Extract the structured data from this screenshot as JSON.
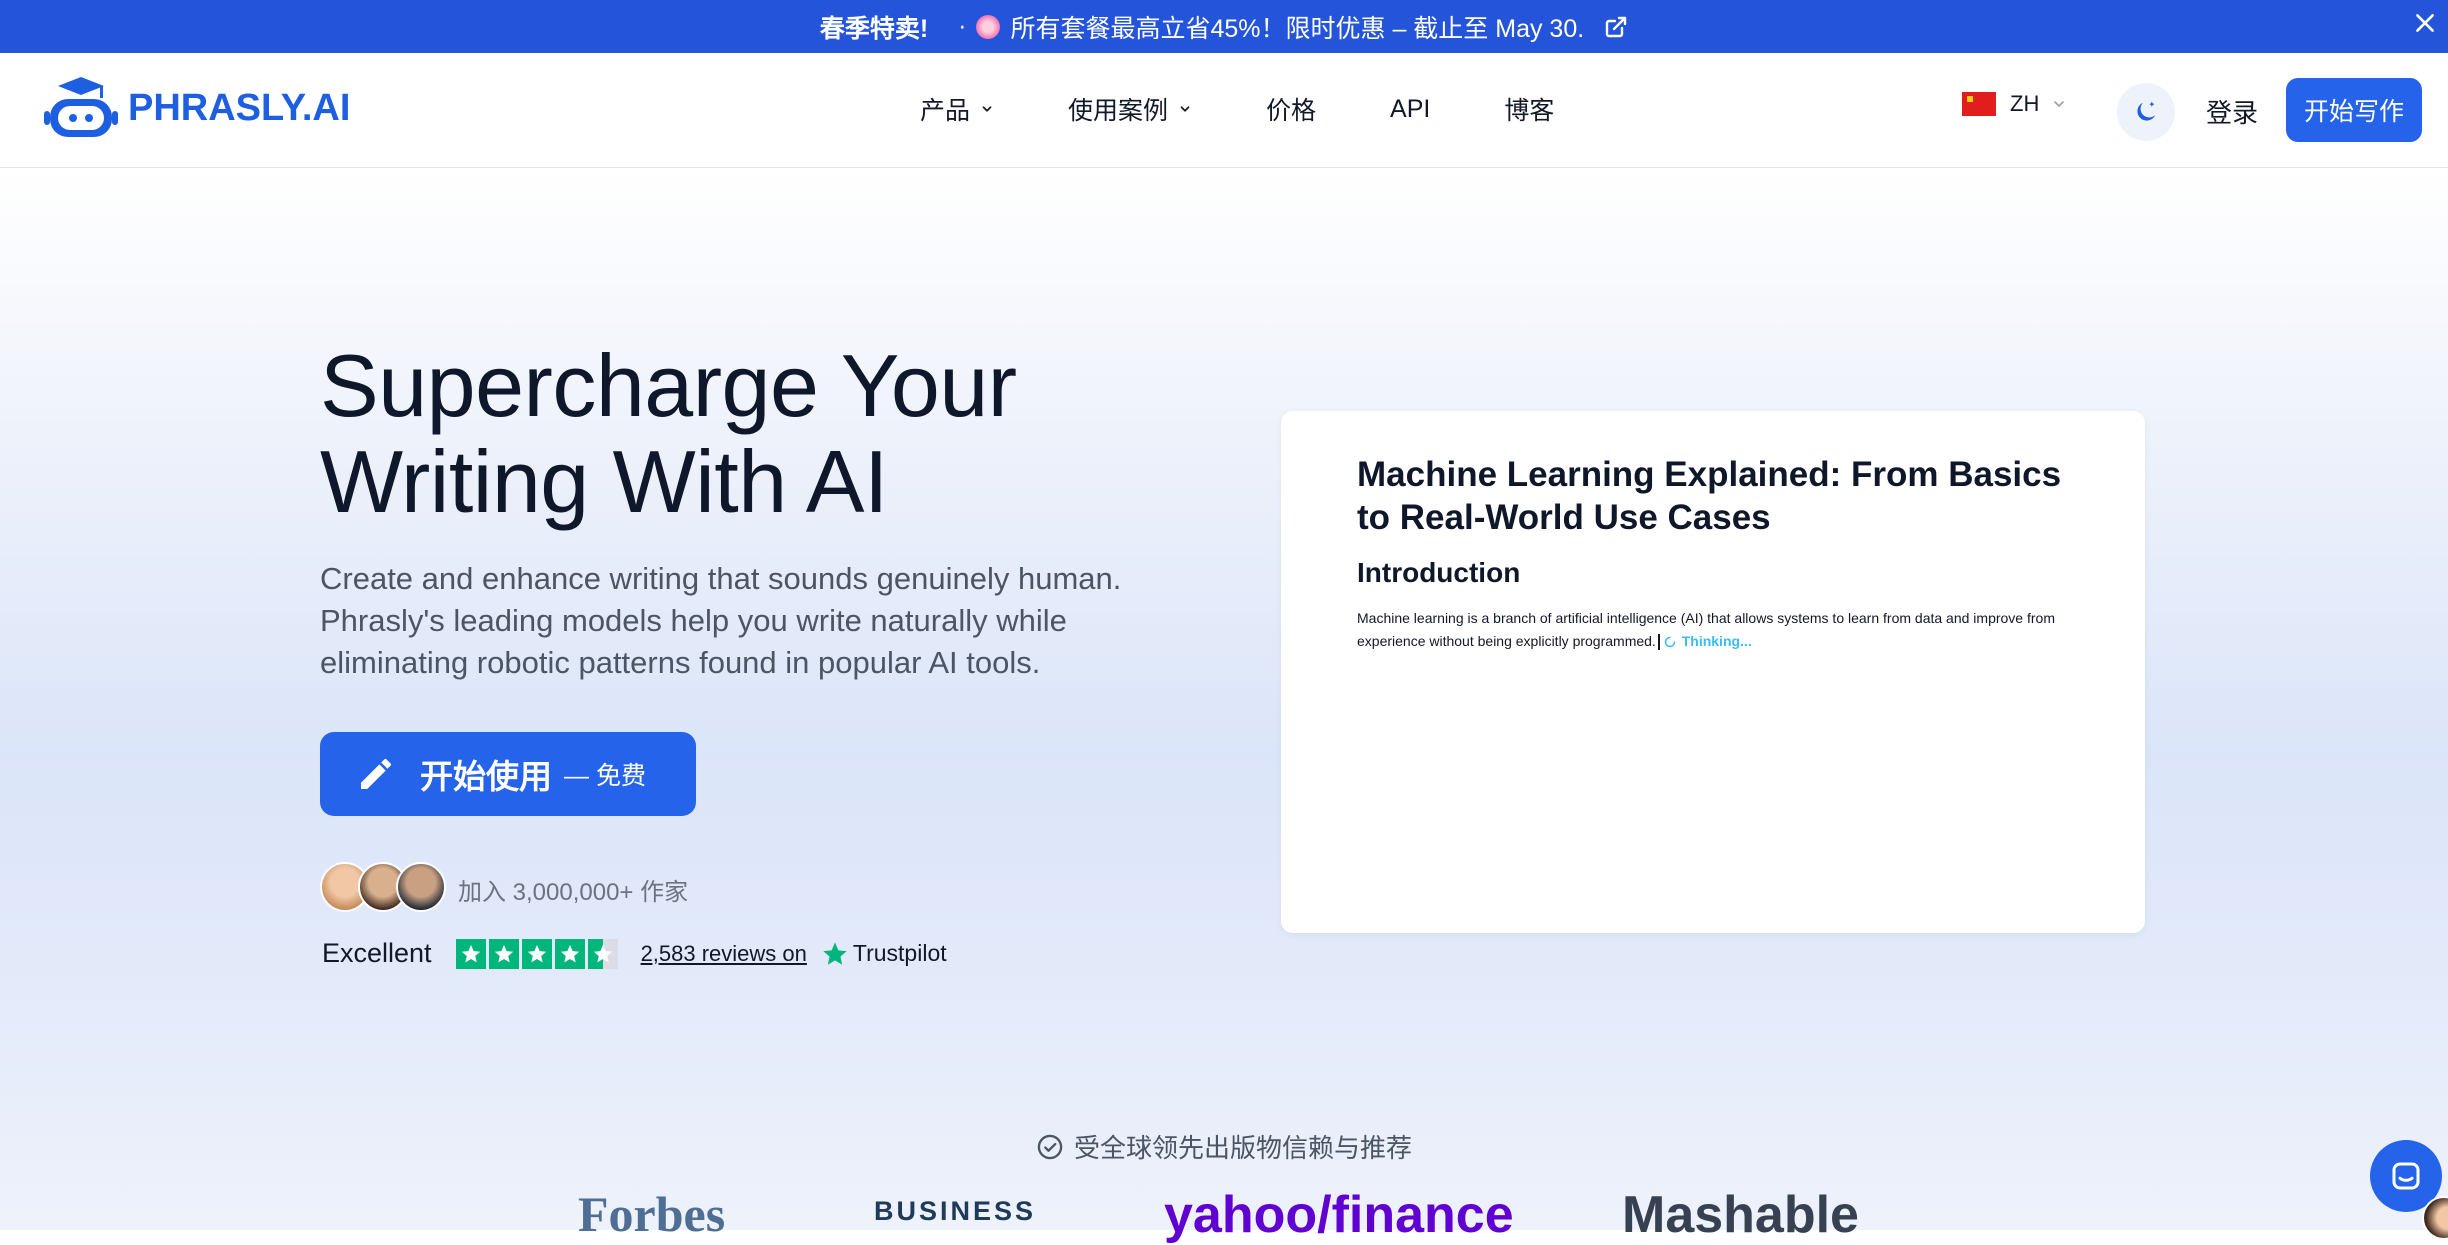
{
  "promo": {
    "highlight": "春季特卖!",
    "separator": "·",
    "message": "所有套餐最高立省45%！限时优惠 – 截止至 May 30."
  },
  "header": {
    "brand": "PHRASLY.AI",
    "nav": [
      {
        "label": "产品",
        "has_dropdown": true
      },
      {
        "label": "使用案例",
        "has_dropdown": true
      },
      {
        "label": "价格",
        "has_dropdown": false
      },
      {
        "label": "API",
        "has_dropdown": false
      },
      {
        "label": "博客",
        "has_dropdown": false
      }
    ],
    "language": "ZH",
    "login": "登录",
    "cta": "开始写作"
  },
  "hero": {
    "title_line1": "Supercharge Your",
    "title_line2": "Writing With AI",
    "subtitle": "Create and enhance writing that sounds genuinely human. Phrasly's leading models help you write naturally while eliminating robotic patterns found in popular AI tools.",
    "cta_label": "开始使用",
    "cta_suffix": "— 免费",
    "join_text": "加入 3,000,000+ 作家",
    "trustpilot": {
      "rating_word": "Excellent",
      "stars": 4.5,
      "reviews": "2,583 reviews on",
      "brand": "Trustpilot"
    }
  },
  "editor": {
    "title": "Machine Learning Explained: From Basics to Real-World Use Cases",
    "heading": "Introduction",
    "paragraph": "Machine learning is a branch of artificial intelligence (AI) that allows systems to learn from data and improve from experience without being explicitly programmed.",
    "status": "Thinking..."
  },
  "press": {
    "title": "受全球领先出版物信赖与推荐",
    "logos": [
      "Forbes",
      "BUSINESS",
      "yahoo/finance",
      "Mashable"
    ]
  },
  "colors": {
    "primary": "#2563eb",
    "promo_bg": "#2454d9",
    "trustpilot_green": "#00b67a",
    "thinking": "#38bdf8"
  }
}
